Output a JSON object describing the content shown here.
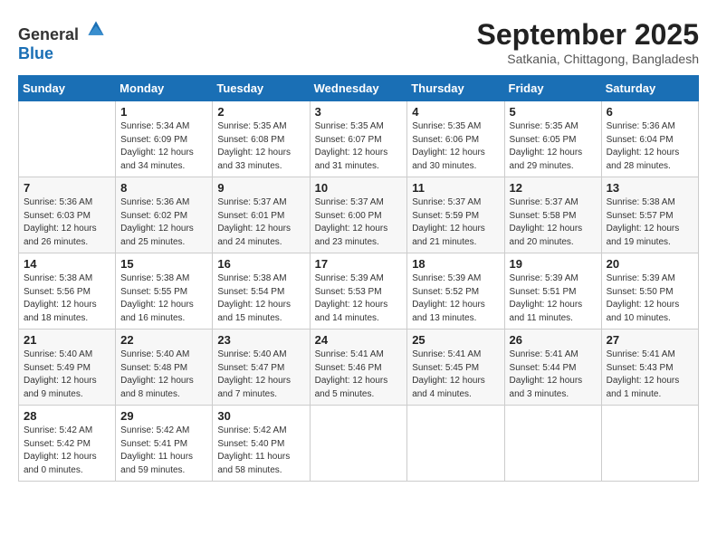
{
  "logo": {
    "general": "General",
    "blue": "Blue"
  },
  "title": "September 2025",
  "subtitle": "Satkania, Chittagong, Bangladesh",
  "weekdays": [
    "Sunday",
    "Monday",
    "Tuesday",
    "Wednesday",
    "Thursday",
    "Friday",
    "Saturday"
  ],
  "weeks": [
    [
      {
        "day": "",
        "info": ""
      },
      {
        "day": "1",
        "info": "Sunrise: 5:34 AM\nSunset: 6:09 PM\nDaylight: 12 hours\nand 34 minutes."
      },
      {
        "day": "2",
        "info": "Sunrise: 5:35 AM\nSunset: 6:08 PM\nDaylight: 12 hours\nand 33 minutes."
      },
      {
        "day": "3",
        "info": "Sunrise: 5:35 AM\nSunset: 6:07 PM\nDaylight: 12 hours\nand 31 minutes."
      },
      {
        "day": "4",
        "info": "Sunrise: 5:35 AM\nSunset: 6:06 PM\nDaylight: 12 hours\nand 30 minutes."
      },
      {
        "day": "5",
        "info": "Sunrise: 5:35 AM\nSunset: 6:05 PM\nDaylight: 12 hours\nand 29 minutes."
      },
      {
        "day": "6",
        "info": "Sunrise: 5:36 AM\nSunset: 6:04 PM\nDaylight: 12 hours\nand 28 minutes."
      }
    ],
    [
      {
        "day": "7",
        "info": "Sunrise: 5:36 AM\nSunset: 6:03 PM\nDaylight: 12 hours\nand 26 minutes."
      },
      {
        "day": "8",
        "info": "Sunrise: 5:36 AM\nSunset: 6:02 PM\nDaylight: 12 hours\nand 25 minutes."
      },
      {
        "day": "9",
        "info": "Sunrise: 5:37 AM\nSunset: 6:01 PM\nDaylight: 12 hours\nand 24 minutes."
      },
      {
        "day": "10",
        "info": "Sunrise: 5:37 AM\nSunset: 6:00 PM\nDaylight: 12 hours\nand 23 minutes."
      },
      {
        "day": "11",
        "info": "Sunrise: 5:37 AM\nSunset: 5:59 PM\nDaylight: 12 hours\nand 21 minutes."
      },
      {
        "day": "12",
        "info": "Sunrise: 5:37 AM\nSunset: 5:58 PM\nDaylight: 12 hours\nand 20 minutes."
      },
      {
        "day": "13",
        "info": "Sunrise: 5:38 AM\nSunset: 5:57 PM\nDaylight: 12 hours\nand 19 minutes."
      }
    ],
    [
      {
        "day": "14",
        "info": "Sunrise: 5:38 AM\nSunset: 5:56 PM\nDaylight: 12 hours\nand 18 minutes."
      },
      {
        "day": "15",
        "info": "Sunrise: 5:38 AM\nSunset: 5:55 PM\nDaylight: 12 hours\nand 16 minutes."
      },
      {
        "day": "16",
        "info": "Sunrise: 5:38 AM\nSunset: 5:54 PM\nDaylight: 12 hours\nand 15 minutes."
      },
      {
        "day": "17",
        "info": "Sunrise: 5:39 AM\nSunset: 5:53 PM\nDaylight: 12 hours\nand 14 minutes."
      },
      {
        "day": "18",
        "info": "Sunrise: 5:39 AM\nSunset: 5:52 PM\nDaylight: 12 hours\nand 13 minutes."
      },
      {
        "day": "19",
        "info": "Sunrise: 5:39 AM\nSunset: 5:51 PM\nDaylight: 12 hours\nand 11 minutes."
      },
      {
        "day": "20",
        "info": "Sunrise: 5:39 AM\nSunset: 5:50 PM\nDaylight: 12 hours\nand 10 minutes."
      }
    ],
    [
      {
        "day": "21",
        "info": "Sunrise: 5:40 AM\nSunset: 5:49 PM\nDaylight: 12 hours\nand 9 minutes."
      },
      {
        "day": "22",
        "info": "Sunrise: 5:40 AM\nSunset: 5:48 PM\nDaylight: 12 hours\nand 8 minutes."
      },
      {
        "day": "23",
        "info": "Sunrise: 5:40 AM\nSunset: 5:47 PM\nDaylight: 12 hours\nand 7 minutes."
      },
      {
        "day": "24",
        "info": "Sunrise: 5:41 AM\nSunset: 5:46 PM\nDaylight: 12 hours\nand 5 minutes."
      },
      {
        "day": "25",
        "info": "Sunrise: 5:41 AM\nSunset: 5:45 PM\nDaylight: 12 hours\nand 4 minutes."
      },
      {
        "day": "26",
        "info": "Sunrise: 5:41 AM\nSunset: 5:44 PM\nDaylight: 12 hours\nand 3 minutes."
      },
      {
        "day": "27",
        "info": "Sunrise: 5:41 AM\nSunset: 5:43 PM\nDaylight: 12 hours\nand 1 minute."
      }
    ],
    [
      {
        "day": "28",
        "info": "Sunrise: 5:42 AM\nSunset: 5:42 PM\nDaylight: 12 hours\nand 0 minutes."
      },
      {
        "day": "29",
        "info": "Sunrise: 5:42 AM\nSunset: 5:41 PM\nDaylight: 11 hours\nand 59 minutes."
      },
      {
        "day": "30",
        "info": "Sunrise: 5:42 AM\nSunset: 5:40 PM\nDaylight: 11 hours\nand 58 minutes."
      },
      {
        "day": "",
        "info": ""
      },
      {
        "day": "",
        "info": ""
      },
      {
        "day": "",
        "info": ""
      },
      {
        "day": "",
        "info": ""
      }
    ]
  ]
}
